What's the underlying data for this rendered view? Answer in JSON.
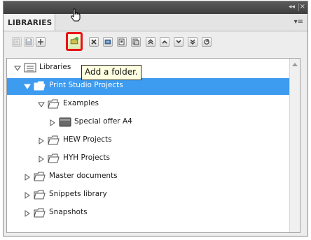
{
  "panel": {
    "title_tab": "LIBRARIES",
    "collapse_glyph": "◂◂",
    "close_glyph": "×",
    "menu_glyph": "▾≡"
  },
  "toolbar": {
    "buttons": [
      {
        "name": "properties-button",
        "icon": "properties-icon",
        "state": "disabled"
      },
      {
        "name": "save-button",
        "icon": "save-icon",
        "state": "disabled"
      },
      {
        "name": "add-library-button",
        "icon": "plus-icon",
        "state": "enabled"
      },
      {
        "name": "add-folder-button",
        "icon": "add-folder-icon",
        "state": "highlighted"
      },
      {
        "name": "delete-button",
        "icon": "delete-icon",
        "state": "enabled"
      },
      {
        "name": "import-button",
        "icon": "import-icon",
        "state": "enabled"
      },
      {
        "name": "export-button",
        "icon": "export-icon",
        "state": "enabled"
      },
      {
        "name": "copy-button",
        "icon": "copy-icon",
        "state": "enabled"
      },
      {
        "name": "move-top-button",
        "icon": "double-chevron-up-icon",
        "state": "enabled"
      },
      {
        "name": "move-up-button",
        "icon": "chevron-up-icon",
        "state": "enabled"
      },
      {
        "name": "move-down-button",
        "icon": "chevron-down-icon",
        "state": "enabled"
      },
      {
        "name": "move-bottom-button",
        "icon": "double-chevron-down-icon",
        "state": "enabled"
      },
      {
        "name": "refresh-button",
        "icon": "refresh-icon",
        "state": "enabled"
      }
    ],
    "highlight_color": "#e81216"
  },
  "tooltip": {
    "text": "Add a folder."
  },
  "tree": {
    "selected_color": "#3d9bf0",
    "items": [
      {
        "label": "Libraries",
        "level": 0,
        "expanded": true,
        "selected": false,
        "kind": "root"
      },
      {
        "label": "Print Studio Projects",
        "level": 1,
        "expanded": true,
        "selected": true,
        "kind": "folder"
      },
      {
        "label": "Examples",
        "level": 2,
        "expanded": true,
        "selected": false,
        "kind": "folder"
      },
      {
        "label": "Special offer A4",
        "level": 3,
        "expanded": false,
        "selected": false,
        "kind": "document"
      },
      {
        "label": "HEW Projects",
        "level": 2,
        "expanded": false,
        "selected": false,
        "kind": "folder"
      },
      {
        "label": "HYH Projects",
        "level": 2,
        "expanded": false,
        "selected": false,
        "kind": "folder"
      },
      {
        "label": "Master documents",
        "level": 1,
        "expanded": false,
        "selected": false,
        "kind": "folder"
      },
      {
        "label": "Snippets library",
        "level": 1,
        "expanded": false,
        "selected": false,
        "kind": "folder"
      },
      {
        "label": "Snapshots",
        "level": 1,
        "expanded": false,
        "selected": false,
        "kind": "folder"
      }
    ]
  }
}
